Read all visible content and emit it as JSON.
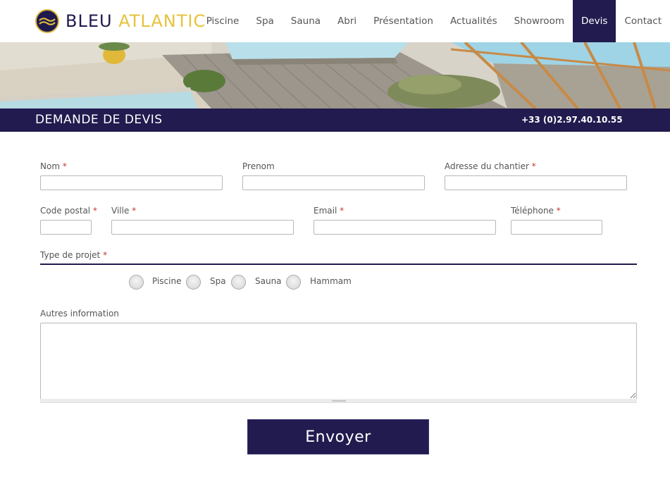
{
  "brand": {
    "word1": "BLEU",
    "word2": "ATLANTIC",
    "primary_color": "#211b4f",
    "accent_color": "#e6c23c"
  },
  "nav": {
    "items": [
      {
        "label": "Piscine",
        "active": false
      },
      {
        "label": "Spa",
        "active": false
      },
      {
        "label": "Sauna",
        "active": false
      },
      {
        "label": "Abri",
        "active": false
      },
      {
        "label": "Présentation",
        "active": false
      },
      {
        "label": "Actualités",
        "active": false
      },
      {
        "label": "Showroom",
        "active": false
      },
      {
        "label": "Devis",
        "active": true
      },
      {
        "label": "Contact",
        "active": false
      }
    ]
  },
  "band": {
    "title": "DEMANDE DE DEVIS",
    "phone": "+33 (0)2.97.40.10.55"
  },
  "form": {
    "required_mark": "*",
    "nom_label": "Nom",
    "prenom_label": "Prenom",
    "adresse_label": "Adresse du chantier",
    "code_postal_label": "Code postal",
    "ville_label": "Ville",
    "email_label": "Email",
    "telephone_label": "Téléphone",
    "type_projet_label": "Type de projet",
    "radios": [
      "Piscine",
      "Spa",
      "Sauna",
      "Hammam"
    ],
    "autres_label": "Autres information",
    "submit_label": "Envoyer"
  }
}
